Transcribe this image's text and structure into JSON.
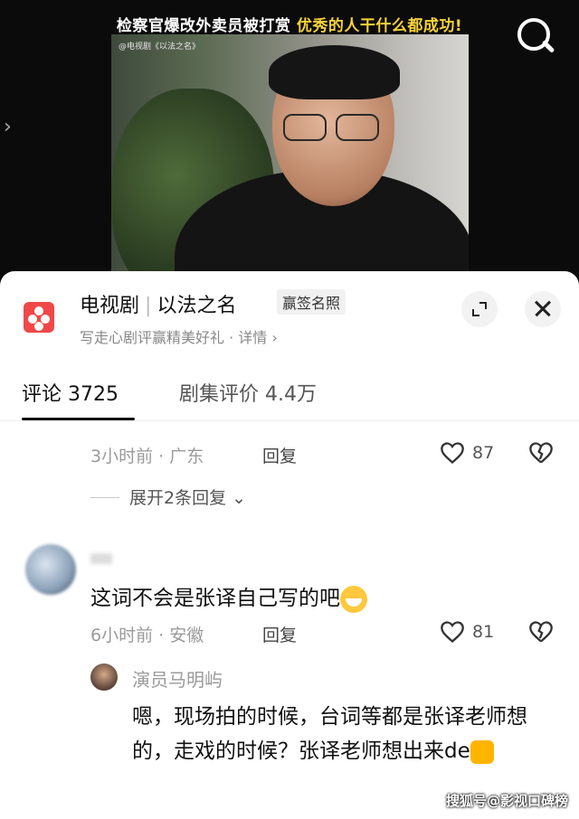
{
  "video": {
    "caption_plain": "检察官爆改外卖员被打赏 ",
    "caption_highlight": "优秀的人干什么都成功!",
    "watermark": "@电视剧《以法之名》"
  },
  "show": {
    "category": "电视剧",
    "name": "以法之名",
    "badge": "赢签名照",
    "subtitle": "写走心剧评赢精美好礼 · 详情 ›"
  },
  "tabs": [
    {
      "label": "评论 3725"
    },
    {
      "label": "剧集评价 4.4万"
    }
  ],
  "comments": [
    {
      "meta": "3小时前 · 广东",
      "reply_label": "回复",
      "likes": "87",
      "expand_label": "展开2条回复"
    },
    {
      "text": "这词不会是张译自己写的吧",
      "meta": "6小时前 · 安徽",
      "reply_label": "回复",
      "likes": "81",
      "reply": {
        "author": "演员马明屿",
        "text": "嗯，现场拍的时候，台词等都是张译老师想的，走戏的时候？张译老师想出来de"
      }
    }
  ],
  "credit": "搜狐号@影视口碑榜",
  "colors": {
    "accent": "#f04848",
    "caption_highlight": "#f5d23a"
  }
}
